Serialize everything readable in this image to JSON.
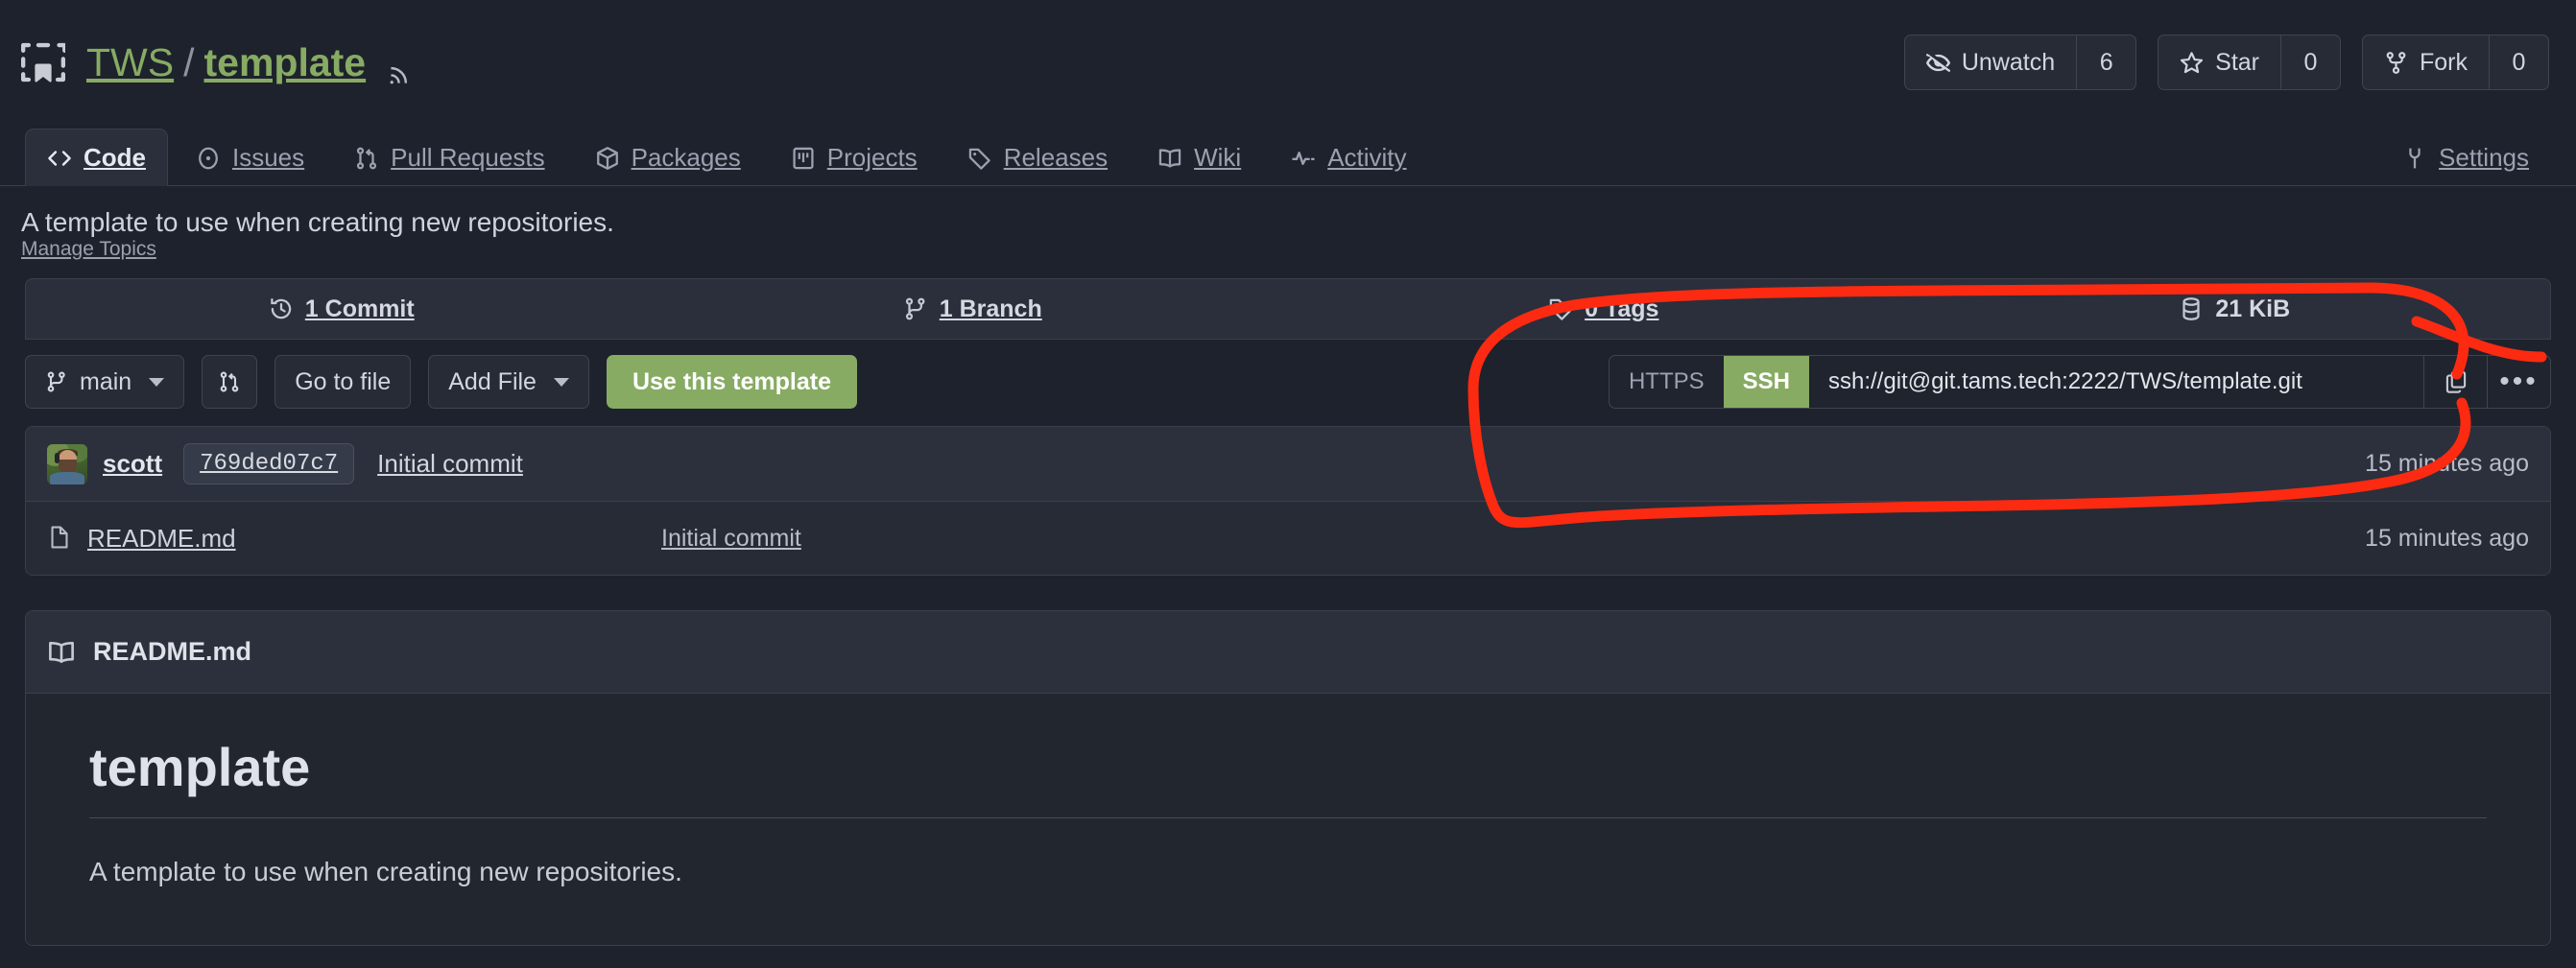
{
  "repo": {
    "owner": "TWS",
    "separator": "/",
    "name": "template",
    "description": "A template to use when creating new repositories.",
    "manage_topics": "Manage Topics"
  },
  "header_actions": {
    "watch": {
      "label": "Unwatch",
      "count": "6",
      "icon": "eye-closed-icon"
    },
    "star": {
      "label": "Star",
      "count": "0",
      "icon": "star-icon"
    },
    "fork": {
      "label": "Fork",
      "count": "0",
      "icon": "fork-icon"
    }
  },
  "nav": {
    "tabs": [
      {
        "label": "Code",
        "icon": "code-icon",
        "active": true
      },
      {
        "label": "Issues",
        "icon": "issue-opened-icon",
        "active": false
      },
      {
        "label": "Pull Requests",
        "icon": "git-pull-request-icon",
        "active": false
      },
      {
        "label": "Packages",
        "icon": "package-icon",
        "active": false
      },
      {
        "label": "Projects",
        "icon": "project-icon",
        "active": false
      },
      {
        "label": "Releases",
        "icon": "tag-icon",
        "active": false
      },
      {
        "label": "Wiki",
        "icon": "book-icon",
        "active": false
      },
      {
        "label": "Activity",
        "icon": "pulse-icon",
        "active": false
      }
    ],
    "settings": {
      "label": "Settings",
      "icon": "wrench-icon"
    }
  },
  "stats": [
    {
      "label": "1 Commit",
      "icon": "history-icon"
    },
    {
      "label": "1 Branch",
      "icon": "git-branch-icon"
    },
    {
      "label": "0 Tags",
      "icon": "tag-icon"
    },
    {
      "label": "21 KiB",
      "icon": "database-icon"
    }
  ],
  "actions": {
    "branch": {
      "label": "main",
      "icon": "git-branch-icon"
    },
    "pull_request_icon": "git-pull-request-icon",
    "go_to_file": "Go to file",
    "add_file": "Add File",
    "use_template": "Use this template"
  },
  "clone": {
    "https_label": "HTTPS",
    "ssh_label": "SSH",
    "active_protocol": "SSH",
    "url": "ssh://git@git.tams.tech:2222/TWS/template.git",
    "copy_icon": "copy-icon",
    "more_label": "•••"
  },
  "commit_row": {
    "author": "scott",
    "sha": "769ded07c7",
    "message": "Initial commit",
    "time": "15 minutes ago",
    "avatar_alt": "scott-avatar"
  },
  "files": [
    {
      "name": "README.md",
      "icon": "file-icon",
      "message": "Initial commit",
      "time": "15 minutes ago"
    }
  ],
  "readme": {
    "title": "README.md",
    "icon": "book-icon",
    "heading": "template",
    "body": "A template to use when creating new repositories."
  },
  "colors": {
    "accent_green": "#87ab63",
    "page_bg": "#1e222c",
    "panel_bg": "#262b36",
    "header_bg": "#2b303c",
    "border": "#3a3f4b",
    "annotation_red": "#fb2a11"
  },
  "annotation": {
    "type": "hand-drawn-circle",
    "target": "clone-url-widget",
    "color": "#fb2a11"
  }
}
